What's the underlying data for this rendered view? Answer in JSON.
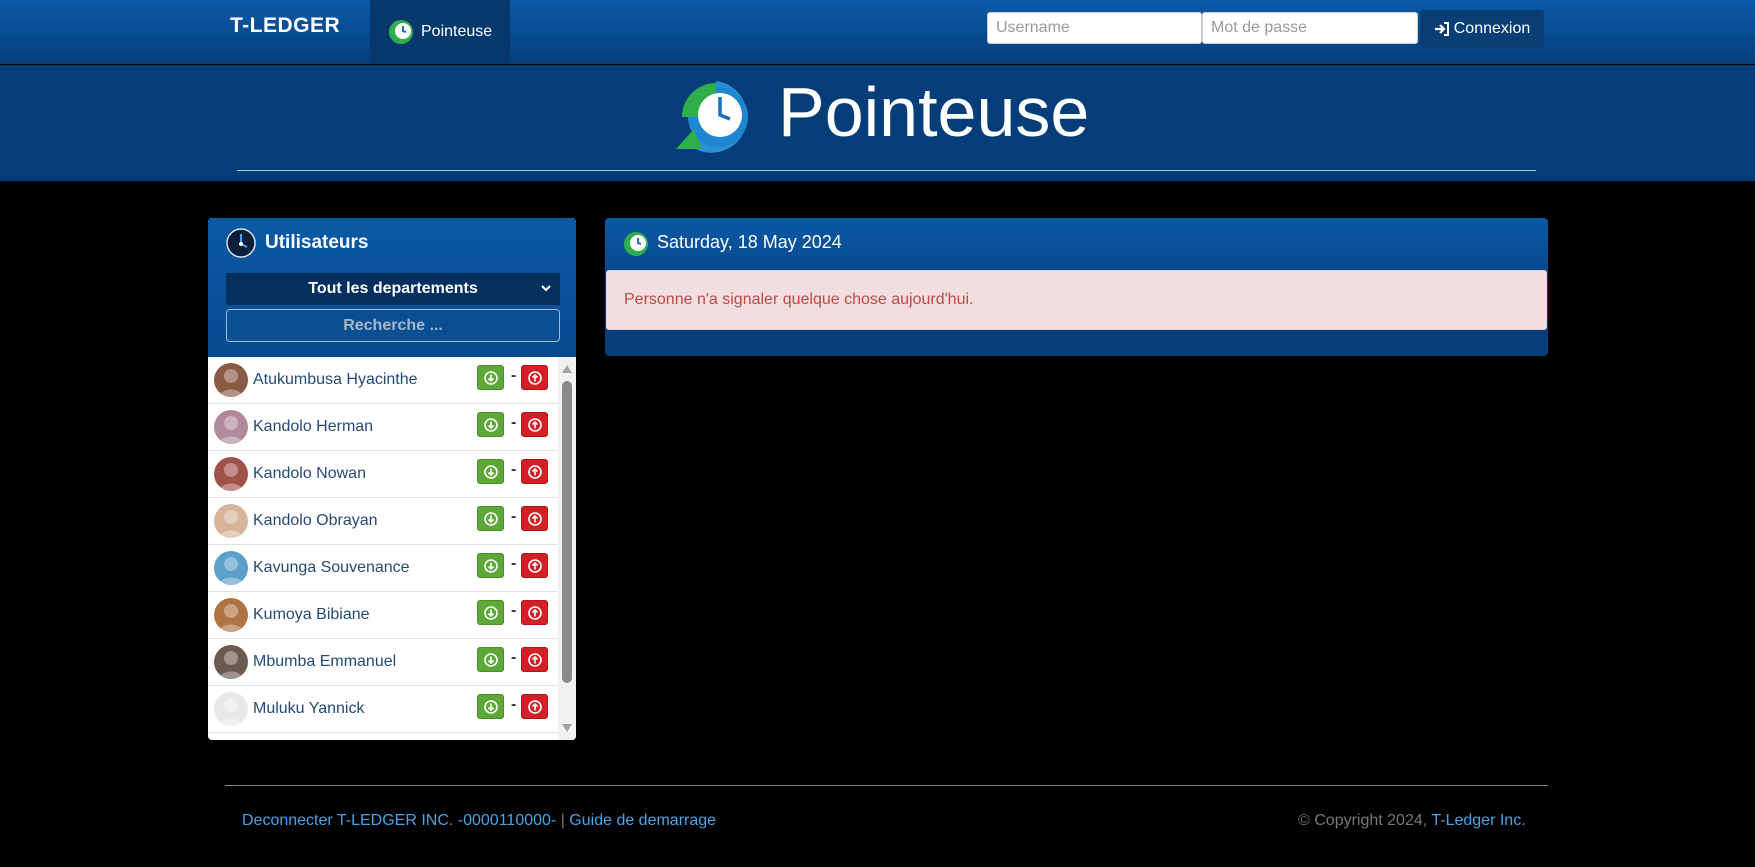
{
  "navbar": {
    "brand": "T-LEDGER",
    "tab_label": "Pointeuse",
    "username_placeholder": "Username",
    "password_placeholder": "Mot de passe",
    "login_label": "Connexion"
  },
  "hero": {
    "title": "Pointeuse"
  },
  "users_panel": {
    "title": "Utilisateurs",
    "department_selected": "Tout les departements",
    "search_placeholder": "Recherche ...",
    "users": [
      {
        "name": "Atukumbusa Hyacinthe",
        "avatar_color": "#8a5a44"
      },
      {
        "name": "Kandolo Herman",
        "avatar_color": "#b08a9a"
      },
      {
        "name": "Kandolo Nowan",
        "avatar_color": "#a0524a"
      },
      {
        "name": "Kandolo Obrayan",
        "avatar_color": "#d6b49a"
      },
      {
        "name": "Kavunga Souvenance",
        "avatar_color": "#5aa0c8"
      },
      {
        "name": "Kumoya Bibiane",
        "avatar_color": "#b07444"
      },
      {
        "name": "Mbumba Emmanuel",
        "avatar_color": "#6a5a50"
      },
      {
        "name": "Muluku Yannick",
        "avatar_color": "#e8e8e8"
      }
    ],
    "separator": "-"
  },
  "date_panel": {
    "date": "Saturday, 18 May 2024",
    "message": "Personne n'a signaler quelque chose aujourd'hui."
  },
  "footer": {
    "disconnect_link": "Deconnecter T-LEDGER INC. -0000110000-",
    "separator": "|",
    "guide_link": "Guide de demarrage",
    "copyright": "© Copyright 2024,",
    "company_link": "T-Ledger Inc."
  },
  "colors": {
    "brand_blue": "#0b59a6",
    "check_in_green": "#5ea838",
    "check_out_red": "#d32027",
    "link_blue": "#4aa3e8"
  }
}
